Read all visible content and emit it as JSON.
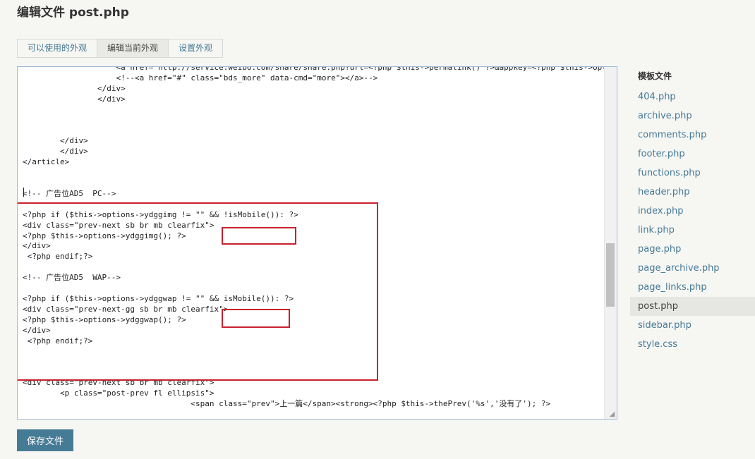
{
  "page": {
    "title": "编辑文件 post.php"
  },
  "tabs": [
    {
      "label": "可以使用的外观"
    },
    {
      "label": "编辑当前外观"
    },
    {
      "label": "设置外观"
    }
  ],
  "editor": {
    "code": "                    <a href=\"http://service.weibo.com/share/share.php?url=<?php $this->permalink() ?>&appkey=<?php $this->options->title(); ?>/&title=<?php $this->title() ?>&pic=<?php if($this->fields->thumb){$this->fields->thumb();}else{echo showThumb($this,null,true);} ?>\" class=\"bds_tsina iconfont icon-weibo-fill\" data-cmd=\"tsina\" title=\"分享到新浪微博\"></a>\n                    <!--<a href=\"#\" class=\"bds_more\" data-cmd=\"more\"></a>-->\n                </div>\n                </div>\n\n\n\n        </div>\n        </div>\n</article>\n\n\n<!-- 广告位AD5  PC-->\n\n<?php if ($this->options->ydggimg != \"\" && !isMobile()): ?>\n<div class=\"prev-next sb br mb clearfix\">\n<?php $this->options->ydggimg(); ?>\n</div>\n <?php endif;?>\n\n<!-- 广告位AD5  WAP-->\n\n<?php if ($this->options->ydggwap != \"\" && isMobile()): ?>\n<div class=\"prev-next-gg sb br mb clearfix\">\n<?php $this->options->ydggwap(); ?>\n</div>\n <?php endif;?>\n\n\n\n<div class=\"prev-next sb br mb clearfix\">\n        <p class=\"post-prev fl ellipsis\">\n                                    <span class=\"prev\">上一篇</span><strong><?php $this->thePrev('%s','没有了'); ?>"
  },
  "save_button": {
    "label": "保存文件"
  },
  "sidebar": {
    "title": "模板文件",
    "files": [
      {
        "label": "404.php"
      },
      {
        "label": "archive.php"
      },
      {
        "label": "comments.php"
      },
      {
        "label": "footer.php"
      },
      {
        "label": "functions.php"
      },
      {
        "label": "header.php"
      },
      {
        "label": "index.php"
      },
      {
        "label": "link.php"
      },
      {
        "label": "page.php"
      },
      {
        "label": "page_archive.php"
      },
      {
        "label": "page_links.php"
      },
      {
        "label": "post.php"
      },
      {
        "label": "sidebar.php"
      },
      {
        "label": "style.css"
      }
    ],
    "active_file": "post.php"
  },
  "colors": {
    "link": "#467b96",
    "button": "#467b96",
    "highlight_box": "#c8212f",
    "editor_border": "#9cb9d6"
  },
  "icons": {
    "resize": "resize-grip-icon"
  }
}
